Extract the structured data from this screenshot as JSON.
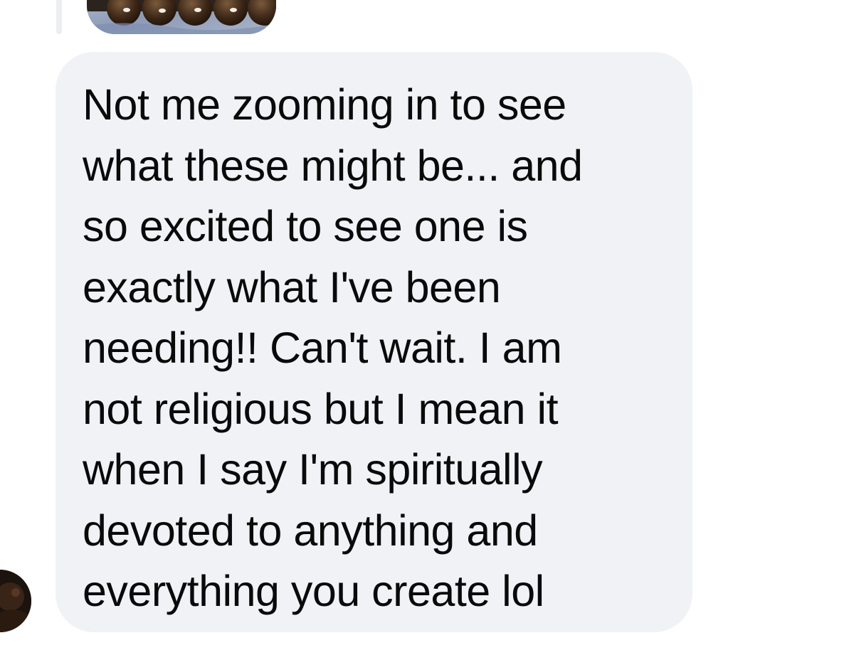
{
  "message": {
    "text": "Not me zooming in to see\nwhat these might be... and\nso excited to see one is\nexactly what I've been\nneeding!! Can't wait. I am\nnot religious but I mean it\nwhen I say I'm spiritually\ndevoted to anything and\neverything you create lol"
  },
  "icons": {
    "avatar": "avatar-image",
    "attachment": "attachment-thumbnail"
  },
  "colors": {
    "bubble_background": "#f0f2f5",
    "text": "#0a0a0a",
    "background": "#ffffff"
  }
}
